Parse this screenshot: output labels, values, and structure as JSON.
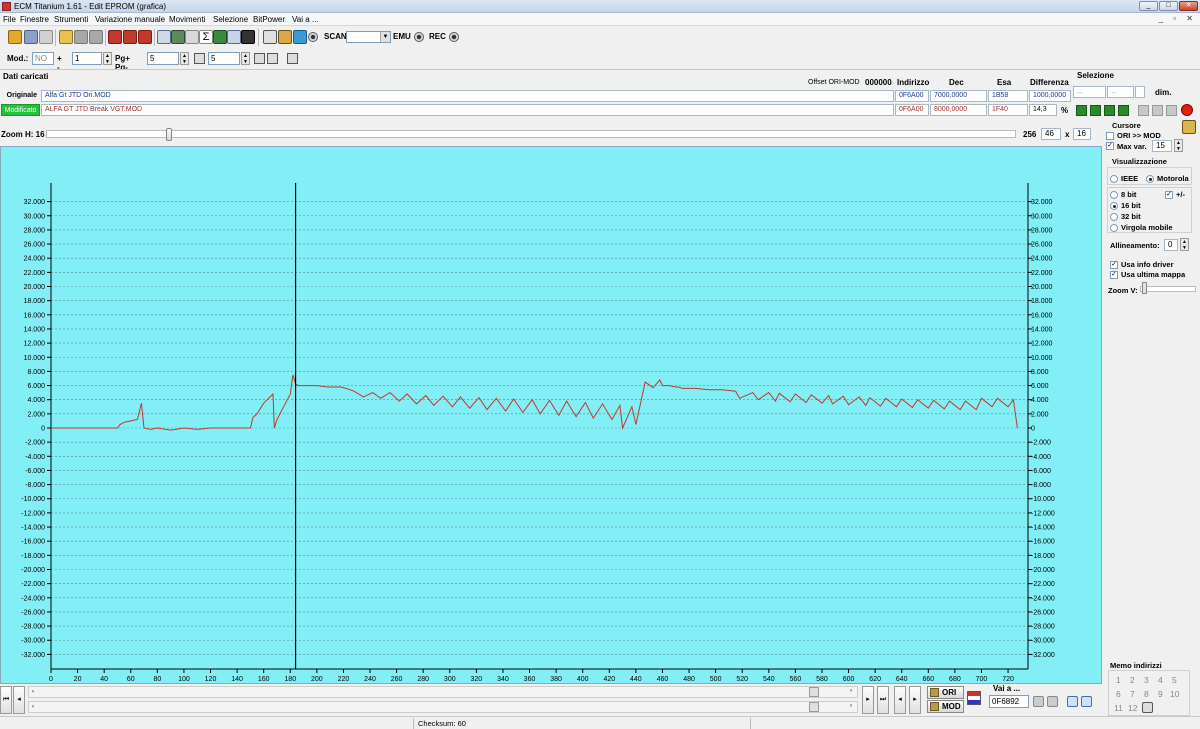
{
  "window": {
    "title": "ECM Titanium 1.61 - Edit EPROM (grafica)",
    "controls": [
      "_",
      "□",
      "✕"
    ]
  },
  "menu": [
    "File",
    "Finestre",
    "Strumenti",
    "Variazione manuale",
    "Movimenti",
    "Selezione",
    "BitPower",
    "Vai a ..."
  ],
  "mdi_controls": "_ ▫ ✕",
  "toolbar1": {
    "scan_label": "SCAN",
    "scan_value": "",
    "emu_label": "EMU",
    "rec_label": "REC"
  },
  "toolbar2": {
    "mod_label": "Mod.:",
    "mod_value": "NO",
    "step_label": "+ -",
    "step_value": "1",
    "pg_label": "Pg+ Pg-",
    "pg_value": "5",
    "t_value": "5"
  },
  "dati": {
    "title": "Dati caricati",
    "offset_label": "Offset ORI-MOD",
    "offset_value": "000000",
    "col_indirizzo": "Indirizzo",
    "col_dec": "Dec",
    "col_esa": "Esa",
    "col_diff": "Differenza",
    "selezione_label": "Selezione",
    "orig": {
      "label": "Originale",
      "file": "Alfa Gt JTD Ori.MOD",
      "indirizzo": "0F6A00",
      "dec": "7000,0000",
      "esa": "1B58",
      "diff": "1000,0000"
    },
    "mod": {
      "label": "Modificato",
      "file": "ALFA GT JTD Break VGT.MOD",
      "indirizzo": "0F6A00",
      "dec": "8000,0000",
      "esa": "1F40",
      "diff": "14,3",
      "diff_unit": "%"
    },
    "sel_from": "...",
    "sel_to": "...",
    "dim_label": "dim."
  },
  "zoom_h": {
    "label": "Zoom H: 16",
    "right_text": "256",
    "w_value": "46",
    "x_symbol": "x",
    "h_value": "16"
  },
  "right_panel": {
    "cursore_title": "Cursore",
    "ori_mod_label": "ORI >> MOD",
    "ori_mod_checked": false,
    "max_var_label": "Max var.",
    "max_var_checked": true,
    "max_var_value": "15",
    "vis_title": "Visualizzazione",
    "ieee_label": "IEEE",
    "motorola_label": "Motorola",
    "bit8_label": "8 bit",
    "plusminus_label": "+/-",
    "bit16_label": "16 bit",
    "bit32_label": "32 bit",
    "virgola_label": "Virgola mobile",
    "allineamento_label": "Allineamento:",
    "allineamento_value": "0",
    "usa_info_label": "Usa info driver",
    "usa_ultima_label": "Usa ultima mappa",
    "zoom_v_label": "Zoom V:",
    "memo_title": "Memo indirizzi",
    "memo_numbers": [
      "1",
      "2",
      "3",
      "4",
      "5",
      "6",
      "7",
      "8",
      "9",
      "10",
      "11",
      "12"
    ]
  },
  "bottom": {
    "ori_label": "ORI",
    "mod_label": "MOD",
    "vai_label": "Vai a ...",
    "vai_value": "0F6892",
    "scroll_left": "‹",
    "scroll_right": "›"
  },
  "status": {
    "checksum": "Checksum: 60"
  },
  "chart_data": {
    "type": "line",
    "xlim": [
      0,
      735
    ],
    "ylim": [
      -33500,
      33500
    ],
    "y_ticks": [
      32000,
      30000,
      28000,
      26000,
      24000,
      22000,
      20000,
      18000,
      16000,
      14000,
      12000,
      10000,
      8000,
      6000,
      4000,
      2000,
      0,
      -2000,
      -4000,
      -6000,
      -8000,
      -10000,
      -12000,
      -14000,
      -16000,
      -18000,
      -20000,
      -22000,
      -24000,
      -26000,
      -28000,
      -30000,
      -32000
    ],
    "y_tick_labels": [
      "32.000",
      "30.000",
      "28.000",
      "26.000",
      "24.000",
      "22.000",
      "20.000",
      "18.000",
      "16.000",
      "14.000",
      "12.000",
      "10.000",
      "8.000",
      "6.000",
      "4.000",
      "2.000",
      "0",
      "-2.000",
      "-4.000",
      "-6.000",
      "-8.000",
      "-10.000",
      "-12.000",
      "-14.000",
      "-16.000",
      "-18.000",
      "-20.000",
      "-22.000",
      "-24.000",
      "-26.000",
      "-28.000",
      "-30.000",
      "-32.000"
    ],
    "x_ticks": [
      "0",
      "20",
      "40",
      "60",
      "80",
      "100",
      "120",
      "140",
      "160",
      "180",
      "200",
      "220",
      "240",
      "260",
      "280",
      "300",
      "320",
      "340",
      "360",
      "380",
      "400",
      "420",
      "440",
      "460",
      "480",
      "500",
      "520",
      "540",
      "560",
      "580",
      "600",
      "620",
      "640",
      "660",
      "680",
      "700",
      "720"
    ],
    "cursor_x": 184,
    "grid": true,
    "colors": {
      "background": "#82eff6",
      "line": "#c0392b",
      "cursor": "#000000",
      "axis": "#000000",
      "grid": "#5a8a8c"
    },
    "series": [
      {
        "x": [
          0,
          50,
          52,
          55,
          60,
          65,
          68,
          70,
          75,
          80,
          90,
          100,
          110,
          120,
          130,
          140,
          150,
          152,
          155,
          160,
          167,
          168,
          170,
          175,
          180,
          182,
          184,
          186,
          200,
          208,
          218,
          222,
          228,
          235,
          242,
          248,
          255,
          262,
          268,
          275,
          282,
          288,
          295,
          302,
          308,
          315,
          322,
          328,
          335,
          342,
          348,
          355,
          362,
          368,
          375,
          382,
          388,
          395,
          402,
          408,
          415,
          422,
          428,
          430,
          437,
          440,
          447,
          453,
          458,
          460,
          465,
          470,
          472,
          475,
          485,
          495,
          505,
          515,
          518,
          528,
          532,
          540,
          545,
          548,
          556,
          560,
          568,
          572,
          580,
          585,
          588,
          596,
          600,
          608,
          613,
          616,
          624,
          628,
          636,
          640,
          648,
          652,
          660,
          664,
          672,
          676,
          684,
          688,
          696,
          700,
          708,
          712,
          720,
          724,
          727
        ],
        "y": [
          0,
          0,
          500,
          800,
          1000,
          1200,
          3500,
          0,
          -200,
          0,
          -300,
          0,
          -200,
          0,
          0,
          0,
          0,
          1500,
          2000,
          3500,
          4800,
          0,
          1200,
          3000,
          4800,
          7500,
          6200,
          6000,
          6000,
          5800,
          5800,
          5600,
          5200,
          4400,
          5000,
          4200,
          5000,
          3800,
          4800,
          3400,
          4600,
          3200,
          4500,
          3000,
          4400,
          2800,
          4300,
          2600,
          4200,
          2400,
          4100,
          2200,
          4000,
          2000,
          3900,
          1800,
          3800,
          1600,
          3600,
          1400,
          3400,
          1200,
          3200,
          0,
          3000,
          500,
          6500,
          5700,
          6800,
          6000,
          6000,
          5800,
          5800,
          5600,
          5600,
          5400,
          5400,
          5200,
          4200,
          5000,
          4000,
          5000,
          3800,
          4900,
          3700,
          4800,
          3600,
          4700,
          3500,
          4600,
          3400,
          4500,
          3300,
          4400,
          3200,
          4300,
          3100,
          4200,
          3000,
          4100,
          2900,
          4000,
          2800,
          3900,
          2700,
          3800,
          2600,
          3800,
          2600,
          4200,
          3000,
          4200,
          3000,
          4000,
          0
        ]
      }
    ]
  }
}
